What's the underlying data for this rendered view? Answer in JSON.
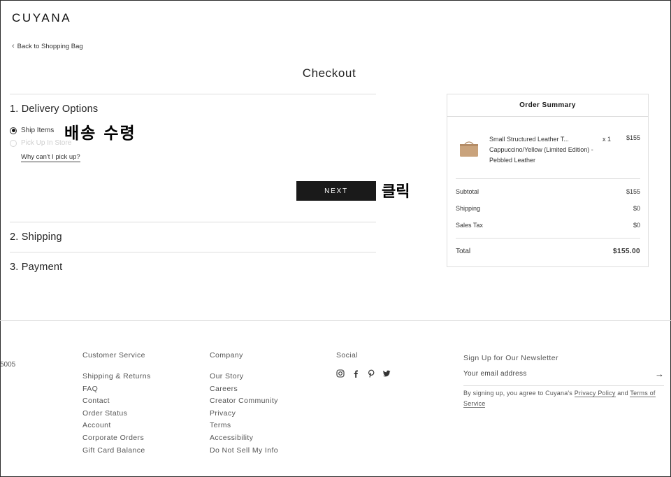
{
  "header": {
    "logo": "CUYANA",
    "back_label": "Back to Shopping Bag",
    "page_title": "Checkout"
  },
  "delivery": {
    "title": "1. Delivery Options",
    "options": [
      {
        "label": "Ship Items",
        "selected": true,
        "disabled": false
      },
      {
        "label": "Pick Up In Store",
        "selected": false,
        "disabled": true
      }
    ],
    "why_link": "Why can't I pick up?",
    "annotation_ship": "배송 수령",
    "next_button": "NEXT",
    "annotation_click": "클릭"
  },
  "sections": {
    "shipping": "2. Shipping",
    "payment": "3. Payment"
  },
  "summary": {
    "title": "Order Summary",
    "item": {
      "name": "Small Structured Leather T... Cappuccino/Yellow (Limited Edition) - Pebbled Leather",
      "qty": "x 1",
      "price": "$155"
    },
    "rows": [
      {
        "label": "Subtotal",
        "value": "$155"
      },
      {
        "label": "Shipping",
        "value": "$0"
      },
      {
        "label": "Sales Tax",
        "value": "$0"
      }
    ],
    "total": {
      "label": "Total",
      "value": "$155.00"
    }
  },
  "footer": {
    "partial_text": "5005",
    "customer_service": {
      "title": "Customer Service",
      "links": [
        "Shipping & Returns",
        "FAQ",
        "Contact",
        "Order Status",
        "Account",
        "Corporate Orders",
        "Gift Card Balance"
      ]
    },
    "company": {
      "title": "Company",
      "links": [
        "Our Story",
        "Careers",
        "Creator Community",
        "Privacy",
        "Terms",
        "Accessibility",
        "Do Not Sell My Info"
      ]
    },
    "social": {
      "title": "Social",
      "icons": [
        "instagram-icon",
        "facebook-icon",
        "pinterest-icon",
        "twitter-icon"
      ]
    },
    "newsletter": {
      "title": "Sign Up for Our Newsletter",
      "placeholder": "Your email address",
      "legal_prefix": "By signing up, you agree to Cuyana's",
      "privacy_link": "Privacy Policy",
      "and": "and",
      "terms_link": "Terms of Service"
    }
  }
}
